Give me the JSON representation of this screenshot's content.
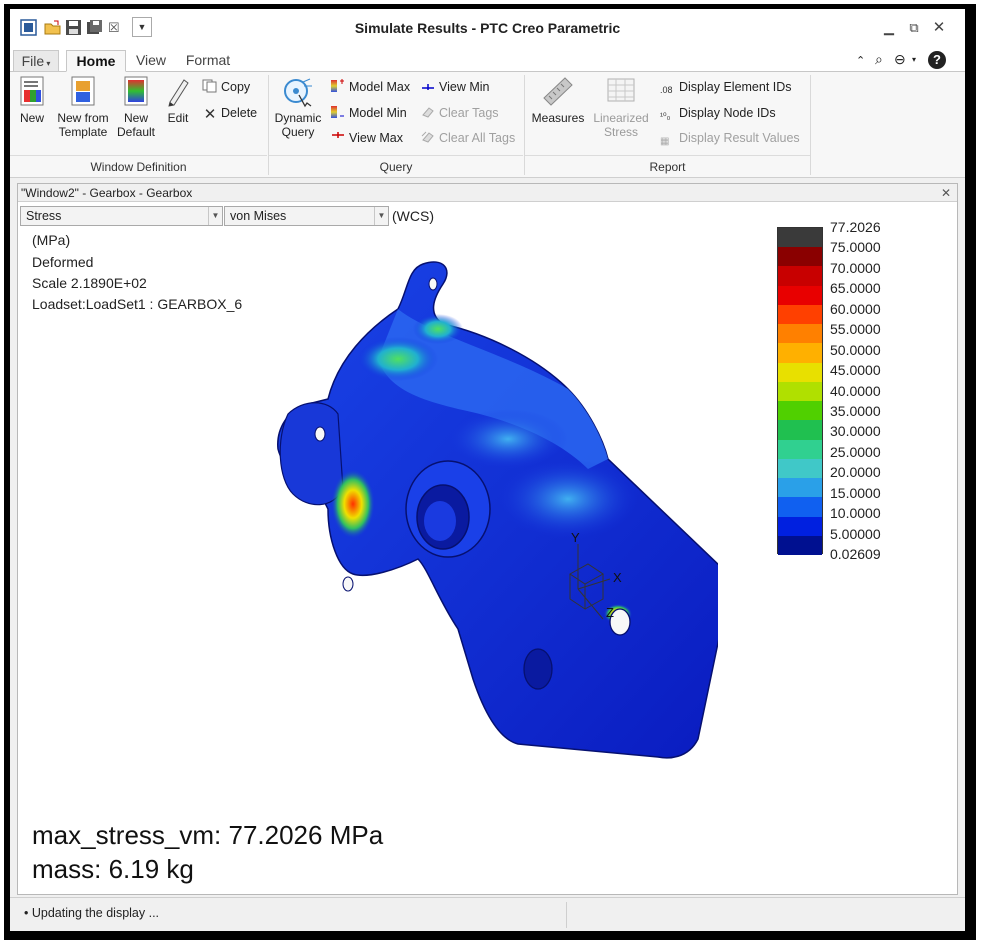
{
  "window": {
    "title": "Simulate Results - PTC Creo Parametric"
  },
  "tabs": {
    "file": "File",
    "home": "Home",
    "view": "View",
    "format": "Format"
  },
  "ribbon": {
    "new": "New",
    "new_from_template_1": "New from",
    "new_from_template_2": "Template",
    "new_default_1": "New",
    "new_default_2": "Default",
    "edit": "Edit",
    "copy": "Copy",
    "delete": "Delete",
    "dynamic_query_1": "Dynamic",
    "dynamic_query_2": "Query",
    "model_max": "Model Max",
    "model_min": "Model Min",
    "view_max": "View Max",
    "view_min": "View Min",
    "clear_tags": "Clear Tags",
    "clear_all_tags": "Clear All Tags",
    "measures": "Measures",
    "linearized_1": "Linearized",
    "linearized_2": "Stress",
    "display_element_ids": "Display Element IDs",
    "display_node_ids": "Display Node IDs",
    "display_result_values": "Display Result Values",
    "groups": {
      "window_definition": "Window Definition",
      "query": "Query",
      "report": "Report"
    }
  },
  "graphics": {
    "title": "\"Window2\" - Gearbox - Gearbox",
    "quantity_select": "Stress",
    "component_select": "von Mises",
    "coord_system": "(WCS)",
    "units": "(MPa)",
    "deformed": "Deformed",
    "scale": "Scale  2.1890E+02",
    "loadset": "Loadset:LoadSet1 :  GEARBOX_6",
    "max_stress": "max_stress_vm: 77.2026 MPa",
    "mass": "mass: 6.19 kg",
    "axis_x": "X",
    "axis_y": "Y",
    "axis_z": "Z"
  },
  "legend": {
    "values": [
      "77.2026",
      "75.0000",
      "70.0000",
      "65.0000",
      "60.0000",
      "55.0000",
      "50.0000",
      "45.0000",
      "40.0000",
      "35.0000",
      "30.0000",
      "25.0000",
      "20.0000",
      "15.0000",
      "10.0000",
      "5.00000",
      "0.02609"
    ],
    "colors": [
      "#3a3a3a",
      "#8a0000",
      "#c80000",
      "#e80000",
      "#ff4000",
      "#ff8000",
      "#ffb000",
      "#e8e000",
      "#b0e000",
      "#50d000",
      "#20c050",
      "#30d090",
      "#40c8c8",
      "#2aa0e8",
      "#1060f0",
      "#0020e0",
      "#001090"
    ]
  },
  "status": {
    "message": "Updating the display ..."
  }
}
